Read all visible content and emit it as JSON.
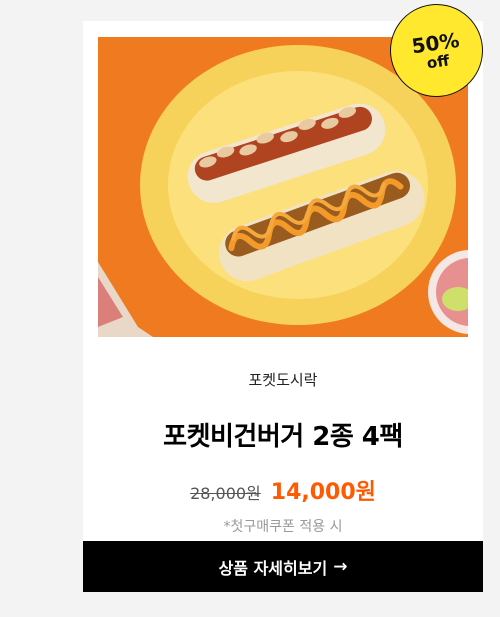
{
  "badge": {
    "percent": "50%",
    "label": "off"
  },
  "product": {
    "brand": "포켓도시락",
    "name": "포켓비건버거 2종 4팩",
    "original_price": "28,000원",
    "sale_price": "14,000원",
    "note": "*첫구매쿠폰 적용 시"
  },
  "cta": {
    "label": "상품 자세히보기",
    "arrow": "→"
  },
  "colors": {
    "accent": "#ff5a00",
    "badge": "#ffe82e",
    "button": "#000000",
    "background": "#f3f3f3"
  },
  "image": {
    "subject": "two hot dogs on a yellow plate over an orange background"
  }
}
